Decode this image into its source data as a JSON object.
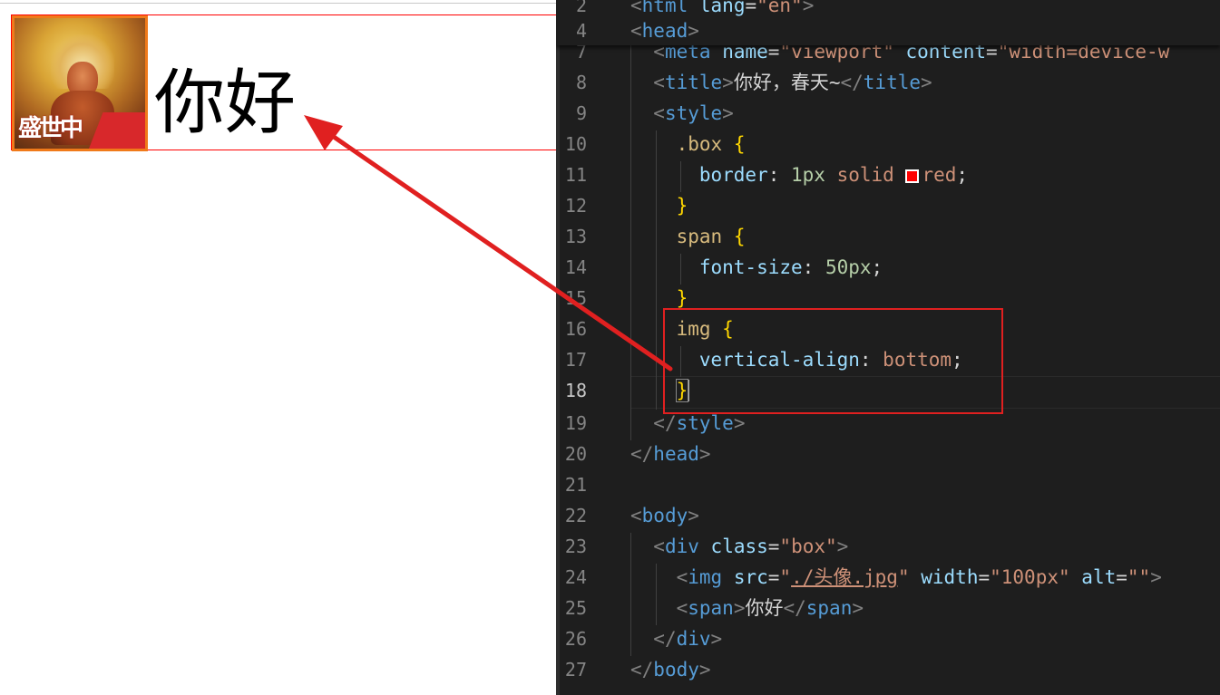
{
  "preview": {
    "text": "你好",
    "avatar_mark": "盛世中国",
    "avatar_icon": "avatar-image"
  },
  "editor": {
    "lines": [
      {
        "num": "2",
        "tokens": [
          [
            "punc",
            "<"
          ],
          [
            "tag",
            "html"
          ],
          [
            "text",
            " "
          ],
          [
            "attr",
            "lang"
          ],
          [
            "text",
            "="
          ],
          [
            "str",
            "\"en\""
          ],
          [
            "punc",
            ">"
          ]
        ]
      },
      {
        "num": "4",
        "tokens": [
          [
            "punc",
            "<"
          ],
          [
            "tag",
            "head"
          ],
          [
            "punc",
            ">"
          ]
        ]
      },
      {
        "num": "7",
        "tokens": [
          [
            "text",
            "  "
          ],
          [
            "punc",
            "<"
          ],
          [
            "tag",
            "meta"
          ],
          [
            "text",
            " "
          ],
          [
            "attr",
            "name"
          ],
          [
            "text",
            "="
          ],
          [
            "str",
            "\"viewport\""
          ],
          [
            "text",
            " "
          ],
          [
            "attr",
            "content"
          ],
          [
            "text",
            "="
          ],
          [
            "str",
            "\"width=device-w"
          ]
        ]
      },
      {
        "num": "8",
        "tokens": [
          [
            "text",
            "  "
          ],
          [
            "punc",
            "<"
          ],
          [
            "tag",
            "title"
          ],
          [
            "punc",
            ">"
          ],
          [
            "text",
            "你好，春天~"
          ],
          [
            "punc",
            "</"
          ],
          [
            "tag",
            "title"
          ],
          [
            "punc",
            ">"
          ]
        ]
      },
      {
        "num": "9",
        "tokens": [
          [
            "text",
            "  "
          ],
          [
            "punc",
            "<"
          ],
          [
            "tag",
            "style"
          ],
          [
            "punc",
            ">"
          ]
        ]
      },
      {
        "num": "10",
        "tokens": [
          [
            "text",
            "    "
          ],
          [
            "sel",
            ".box"
          ],
          [
            "text",
            " "
          ],
          [
            "brace",
            "{"
          ]
        ]
      },
      {
        "num": "11",
        "tokens": [
          [
            "text",
            "      "
          ],
          [
            "prop",
            "border"
          ],
          [
            "text",
            ": "
          ],
          [
            "num",
            "1px"
          ],
          [
            "text",
            " "
          ],
          [
            "val",
            "solid"
          ],
          [
            "text",
            " "
          ],
          [
            "swatch",
            ""
          ],
          [
            "val",
            "red"
          ],
          [
            "text",
            ";"
          ]
        ]
      },
      {
        "num": "12",
        "tokens": [
          [
            "text",
            "    "
          ],
          [
            "brace",
            "}"
          ]
        ]
      },
      {
        "num": "13",
        "tokens": [
          [
            "text",
            "    "
          ],
          [
            "sel",
            "span"
          ],
          [
            "text",
            " "
          ],
          [
            "brace",
            "{"
          ]
        ]
      },
      {
        "num": "14",
        "tokens": [
          [
            "text",
            "      "
          ],
          [
            "prop",
            "font-size"
          ],
          [
            "text",
            ": "
          ],
          [
            "num",
            "50px"
          ],
          [
            "text",
            ";"
          ]
        ]
      },
      {
        "num": "15",
        "tokens": [
          [
            "text",
            "    "
          ],
          [
            "brace",
            "}"
          ]
        ]
      },
      {
        "num": "16",
        "tokens": [
          [
            "text",
            "    "
          ],
          [
            "sel",
            "img"
          ],
          [
            "text",
            " "
          ],
          [
            "brace",
            "{"
          ]
        ]
      },
      {
        "num": "17",
        "tokens": [
          [
            "text",
            "      "
          ],
          [
            "prop",
            "vertical-align"
          ],
          [
            "text",
            ": "
          ],
          [
            "val",
            "bottom"
          ],
          [
            "text",
            ";"
          ]
        ]
      },
      {
        "num": "18",
        "active": true,
        "tokens": [
          [
            "text",
            "    "
          ],
          [
            "bracecur",
            "}"
          ]
        ]
      },
      {
        "num": "19",
        "tokens": [
          [
            "text",
            "  "
          ],
          [
            "punc",
            "</"
          ],
          [
            "tag",
            "style"
          ],
          [
            "punc",
            ">"
          ]
        ]
      },
      {
        "num": "20",
        "tokens": [
          [
            "punc",
            "</"
          ],
          [
            "tag",
            "head"
          ],
          [
            "punc",
            ">"
          ]
        ]
      },
      {
        "num": "21",
        "tokens": []
      },
      {
        "num": "22",
        "tokens": [
          [
            "punc",
            "<"
          ],
          [
            "tag",
            "body"
          ],
          [
            "punc",
            ">"
          ]
        ]
      },
      {
        "num": "23",
        "tokens": [
          [
            "text",
            "  "
          ],
          [
            "punc",
            "<"
          ],
          [
            "tag",
            "div"
          ],
          [
            "text",
            " "
          ],
          [
            "attr",
            "class"
          ],
          [
            "text",
            "="
          ],
          [
            "str",
            "\"box\""
          ],
          [
            "punc",
            ">"
          ]
        ]
      },
      {
        "num": "24",
        "tokens": [
          [
            "text",
            "    "
          ],
          [
            "punc",
            "<"
          ],
          [
            "tag",
            "img"
          ],
          [
            "text",
            " "
          ],
          [
            "attr",
            "src"
          ],
          [
            "text",
            "="
          ],
          [
            "str",
            "\""
          ],
          [
            "link",
            "./头像.jpg"
          ],
          [
            "str",
            "\""
          ],
          [
            "text",
            " "
          ],
          [
            "attr",
            "width"
          ],
          [
            "text",
            "="
          ],
          [
            "str",
            "\"100px\""
          ],
          [
            "text",
            " "
          ],
          [
            "attr",
            "alt"
          ],
          [
            "text",
            "="
          ],
          [
            "str",
            "\"\""
          ],
          [
            "punc",
            ">"
          ]
        ]
      },
      {
        "num": "25",
        "tokens": [
          [
            "text",
            "    "
          ],
          [
            "punc",
            "<"
          ],
          [
            "tag",
            "span"
          ],
          [
            "punc",
            ">"
          ],
          [
            "text",
            "你好"
          ],
          [
            "punc",
            "</"
          ],
          [
            "tag",
            "span"
          ],
          [
            "punc",
            ">"
          ]
        ]
      },
      {
        "num": "26",
        "tokens": [
          [
            "text",
            "  "
          ],
          [
            "punc",
            "</"
          ],
          [
            "tag",
            "div"
          ],
          [
            "punc",
            ">"
          ]
        ]
      },
      {
        "num": "27",
        "tokens": [
          [
            "punc",
            "</"
          ],
          [
            "tag",
            "body"
          ],
          [
            "punc",
            ">"
          ]
        ]
      }
    ]
  },
  "annotation": {
    "highlight_color": "#e02020",
    "arrow_icon": "red-arrow"
  }
}
